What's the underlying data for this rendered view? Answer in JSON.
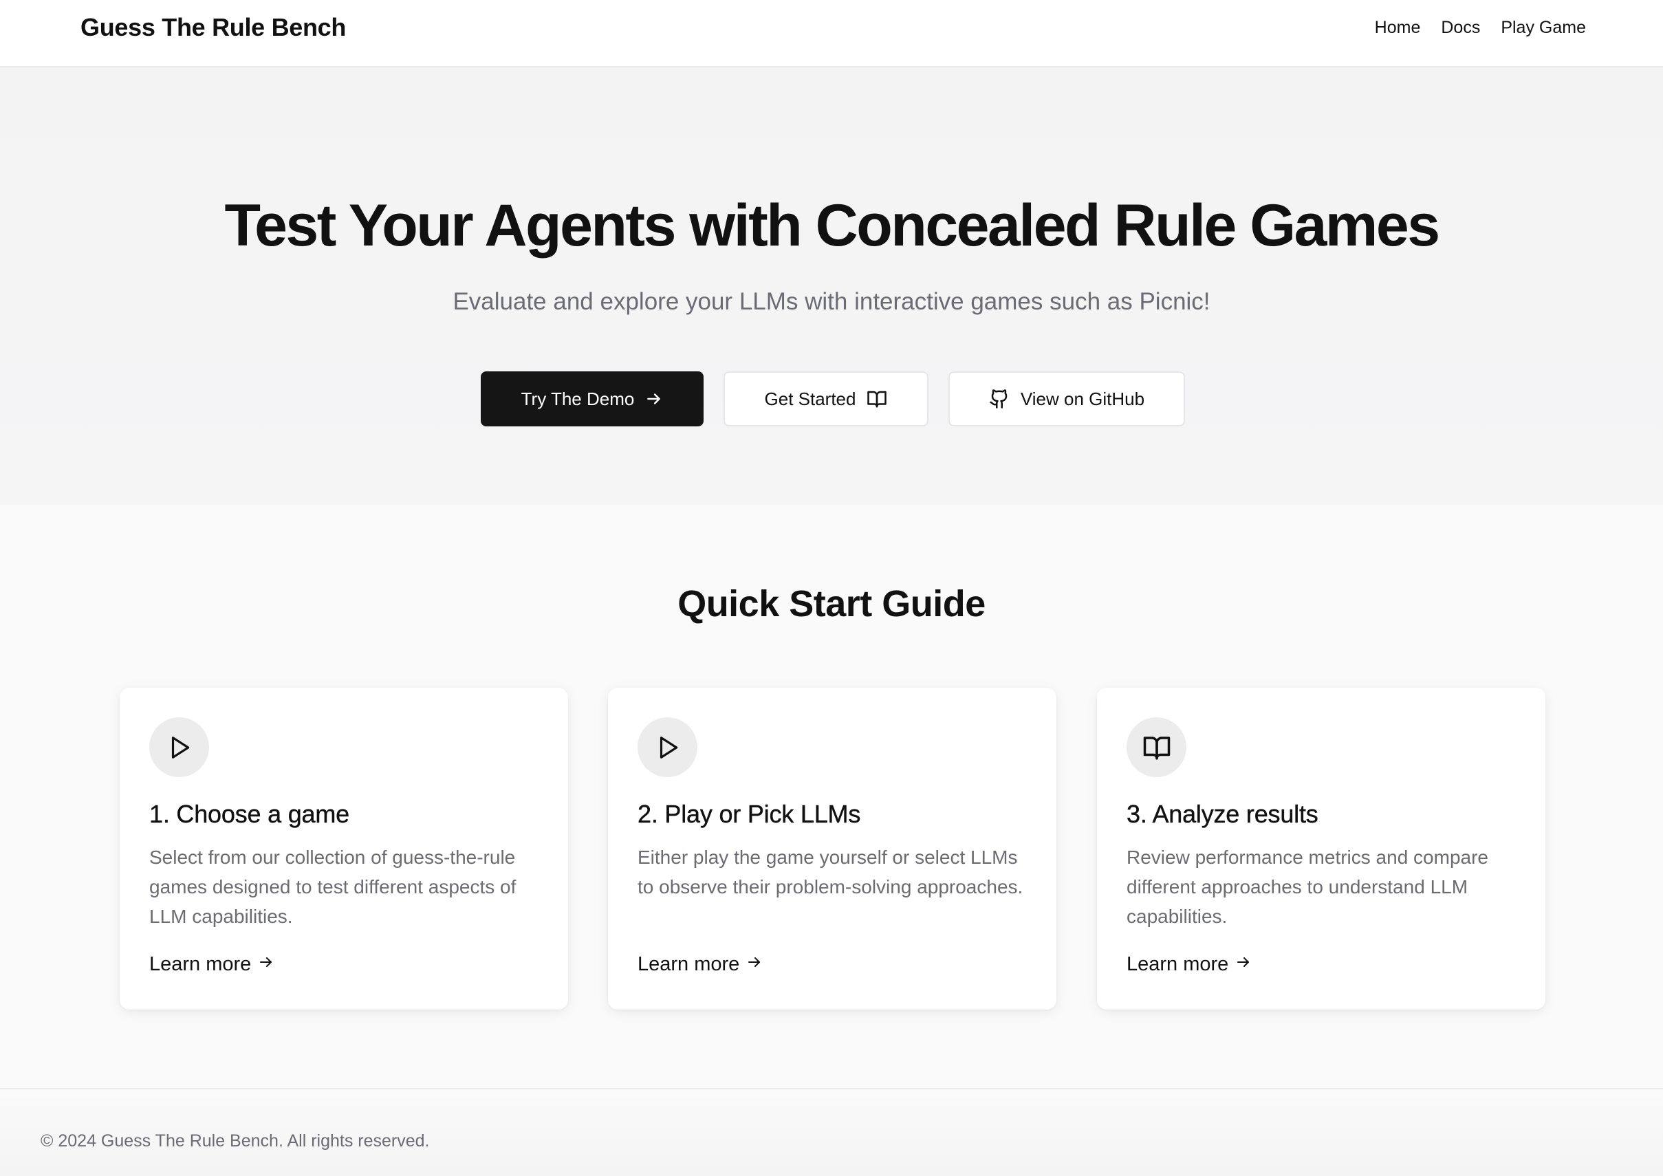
{
  "header": {
    "brand": "Guess The Rule Bench",
    "nav": [
      {
        "label": "Home"
      },
      {
        "label": "Docs"
      },
      {
        "label": "Play Game"
      }
    ]
  },
  "hero": {
    "title": "Test Your Agents with Concealed Rule Games",
    "subtitle": "Evaluate and explore your LLMs with interactive games such as Picnic!",
    "buttons": {
      "demo": {
        "label": "Try The Demo",
        "icon": "arrow-right-icon"
      },
      "start": {
        "label": "Get Started",
        "icon": "book-open-icon"
      },
      "github": {
        "label": "View on GitHub",
        "icon": "github-icon"
      }
    }
  },
  "quickstart": {
    "title": "Quick Start Guide",
    "cards": [
      {
        "icon": "play-icon",
        "title": "1. Choose a game",
        "description": "Select from our collection of guess-the-rule games designed to test different aspects of LLM capabilities.",
        "link": "Learn more"
      },
      {
        "icon": "play-icon",
        "title": "2. Play or Pick LLMs",
        "description": "Either play the game yourself or select LLMs to observe their problem-solving approaches.",
        "link": "Learn more"
      },
      {
        "icon": "book-open-icon",
        "title": "3. Analyze results",
        "description": "Review performance metrics and compare different approaches to understand LLM capabilities.",
        "link": "Learn more"
      }
    ]
  },
  "footer": {
    "copyright": "© 2024 Guess The Rule Bench. All rights reserved."
  },
  "colors": {
    "primary_button": "#151516",
    "muted_text": "#6b6b73",
    "icon_circle": "#ececed"
  }
}
